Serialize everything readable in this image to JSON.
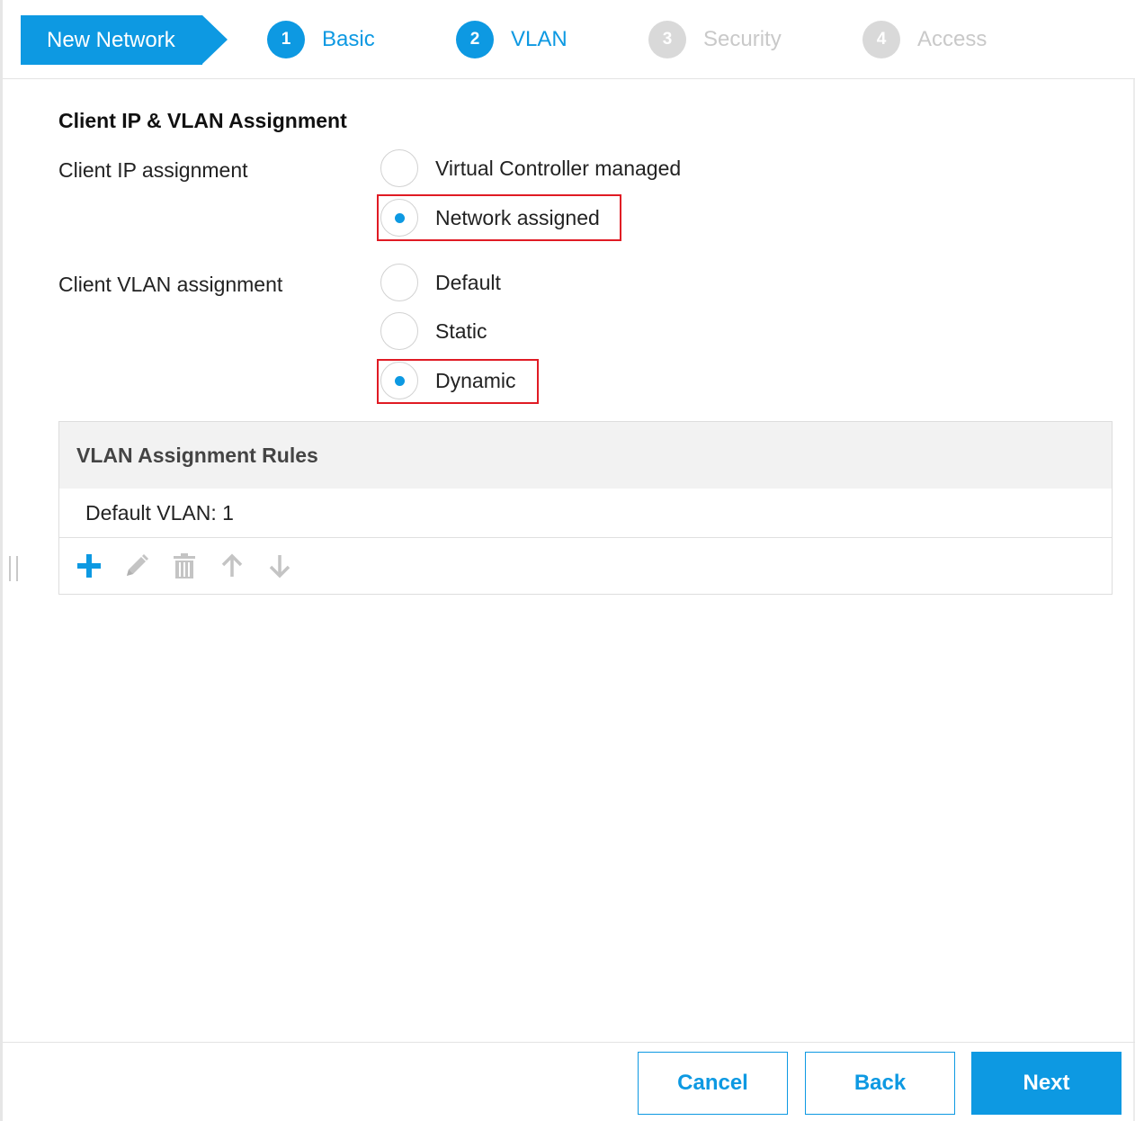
{
  "wizard": {
    "title": "New Network",
    "steps": [
      {
        "number": "1",
        "label": "Basic",
        "state": "active"
      },
      {
        "number": "2",
        "label": "VLAN",
        "state": "active"
      },
      {
        "number": "3",
        "label": "Security",
        "state": "inactive"
      },
      {
        "number": "4",
        "label": "Access",
        "state": "inactive"
      }
    ]
  },
  "form": {
    "section_title": "Client IP & VLAN Assignment",
    "client_ip": {
      "label": "Client IP assignment",
      "options": [
        "Virtual Controller managed",
        "Network assigned"
      ],
      "selected": "Network assigned"
    },
    "client_vlan": {
      "label": "Client VLAN assignment",
      "options": [
        "Default",
        "Static",
        "Dynamic"
      ],
      "selected": "Dynamic"
    }
  },
  "vlan_rules": {
    "title": "VLAN Assignment Rules",
    "rows": [
      "Default VLAN: 1"
    ],
    "toolbar": [
      "add-icon",
      "edit-icon",
      "delete-icon",
      "move-up-icon",
      "move-down-icon"
    ]
  },
  "footer": {
    "cancel_label": "Cancel",
    "back_label": "Back",
    "next_label": "Next"
  },
  "colors": {
    "accent": "#0d99e2",
    "highlight": "#e01b24",
    "inactive": "#d9d9d9"
  }
}
